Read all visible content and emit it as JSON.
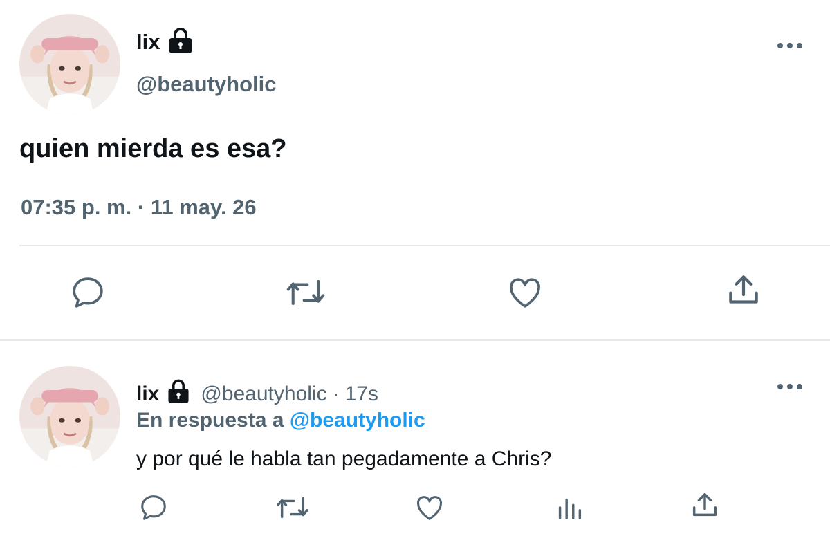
{
  "main_tweet": {
    "display_name": "lix",
    "handle": "@beautyholic",
    "text": "quien mierda es esa?",
    "time": "07:35 p. m.",
    "separator": " · ",
    "date": "11 may. 26",
    "icons": [
      "lock-icon",
      "more-icon",
      "reply-icon",
      "retweet-icon",
      "like-icon",
      "share-icon"
    ]
  },
  "reply_tweet": {
    "display_name": "lix",
    "handle": "@beautyholic",
    "separator": "·",
    "time": "17s",
    "reply_prefix": "En respuesta a ",
    "reply_mention": "@beautyholic",
    "text": "y por qué le habla tan pegadamente a Chris?",
    "icons": [
      "lock-icon",
      "more-icon",
      "reply-icon",
      "retweet-icon",
      "like-icon",
      "stats-icon",
      "share-icon"
    ]
  },
  "colors": {
    "text": "#0f1419",
    "secondary": "#536471",
    "mention": "#1d9bf0",
    "divider": "#e7e9eb",
    "icon": "#536471"
  }
}
